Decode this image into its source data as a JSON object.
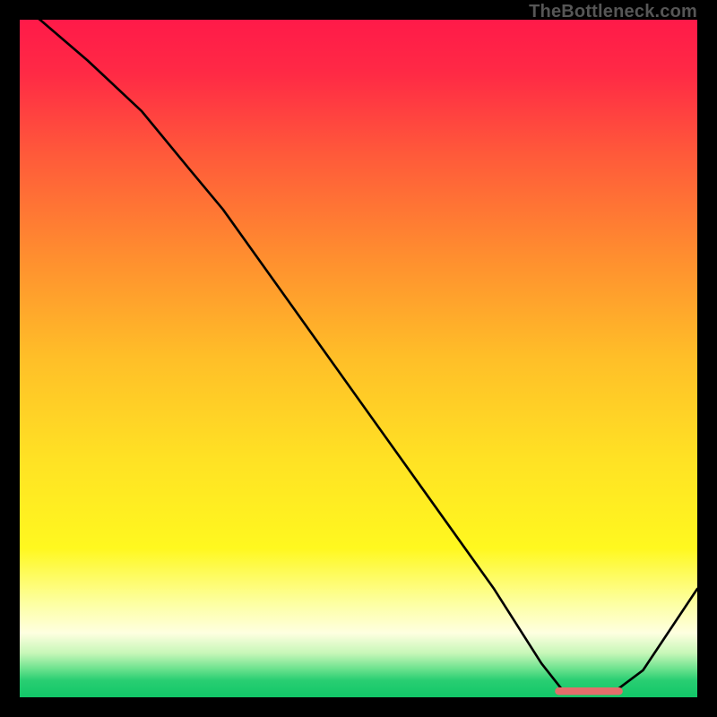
{
  "watermark": "TheBottleneck.com",
  "chart_data": {
    "type": "line",
    "title": "",
    "xlabel": "",
    "ylabel": "",
    "xlim": [
      0,
      100
    ],
    "ylim": [
      0,
      100
    ],
    "grid": false,
    "legend": false,
    "background": {
      "type": "vertical-gradient",
      "stops": [
        {
          "pos": 0.0,
          "color": "#ff1a49"
        },
        {
          "pos": 0.08,
          "color": "#ff2a45"
        },
        {
          "pos": 0.2,
          "color": "#ff5a3a"
        },
        {
          "pos": 0.35,
          "color": "#ff8e2f"
        },
        {
          "pos": 0.5,
          "color": "#ffbf28"
        },
        {
          "pos": 0.65,
          "color": "#ffe224"
        },
        {
          "pos": 0.78,
          "color": "#fff81f"
        },
        {
          "pos": 0.86,
          "color": "#fdffa0"
        },
        {
          "pos": 0.905,
          "color": "#feffe0"
        },
        {
          "pos": 0.935,
          "color": "#c7f7b8"
        },
        {
          "pos": 0.958,
          "color": "#6ce28e"
        },
        {
          "pos": 0.975,
          "color": "#29ce72"
        },
        {
          "pos": 1.0,
          "color": "#11c768"
        }
      ]
    },
    "series": [
      {
        "name": "bottleneck-curve",
        "color": "#000000",
        "width": 2.2,
        "x": [
          0,
          3,
          10,
          18,
          25,
          30,
          40,
          50,
          60,
          70,
          77,
          80,
          84,
          88,
          92,
          100
        ],
        "y": [
          102,
          100,
          94,
          86.5,
          78,
          72,
          58,
          44,
          30,
          16,
          5,
          1.2,
          0.8,
          1.0,
          4,
          16
        ]
      }
    ],
    "marker": {
      "name": "optimal-range",
      "color": "#e36e6b",
      "x_start": 79,
      "x_end": 89,
      "y": 0.9,
      "thickness": 1.1
    }
  }
}
